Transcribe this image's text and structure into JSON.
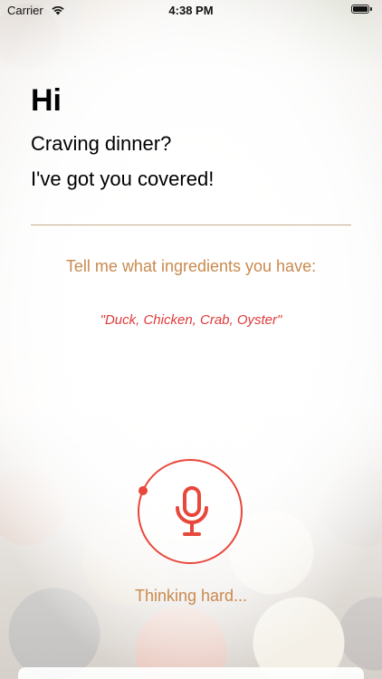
{
  "status_bar": {
    "carrier": "Carrier",
    "time": "4:38 PM"
  },
  "greeting": {
    "title": "Hi",
    "line1": "Craving dinner?",
    "line2": "I've got you covered!"
  },
  "prompt": {
    "label": "Tell me what ingredients you have:",
    "example": "\"Duck, Chicken, Crab, Oyster\""
  },
  "voice": {
    "status": "Thinking hard..."
  },
  "colors": {
    "accent": "#e8473b",
    "label": "#c98a4e",
    "example": "#e03a3a"
  },
  "icons": {
    "mic": "microphone-icon",
    "wifi": "wifi-icon",
    "battery": "battery-icon"
  }
}
